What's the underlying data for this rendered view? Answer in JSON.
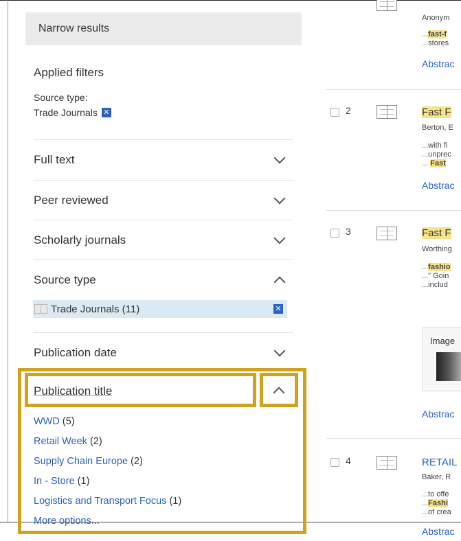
{
  "sidebar": {
    "header": "Narrow results",
    "applied_filters": {
      "title": "Applied filters",
      "source_type_label": "Source type:",
      "source_type_value": "Trade Journals",
      "remove_glyph": "✕"
    },
    "facets": [
      "Full text",
      "Peer reviewed",
      "Scholarly journals",
      "Source type",
      "Publication date"
    ],
    "source_type_selected": "Trade Journals (11)",
    "publication_title": {
      "label": "Publication title",
      "options": [
        {
          "name": "WWD",
          "count": "(5)"
        },
        {
          "name": "Retail Week",
          "count": "(2)"
        },
        {
          "name": "Supply Chain Europe",
          "count": "(2)"
        },
        {
          "name": "In - Store",
          "count": "(1)"
        },
        {
          "name": "Logistics and Transport Focus",
          "count": "(1)"
        }
      ],
      "more_options": "More options..."
    }
  },
  "results": {
    "r1": {
      "author": "Anonym",
      "snip1_pre": "...",
      "snip1_mark": "fast-f",
      "snip2": "...stores",
      "abstract": "Abstrac"
    },
    "r2": {
      "num": "2",
      "title_mark": "Fast F",
      "author": "Berton, E",
      "snip1": "...with fi",
      "snip2": "...unprec",
      "snip3_pre": "...  ",
      "snip3_mark": "Fast",
      "abstract": "Abstrac"
    },
    "r3": {
      "num": "3",
      "title_mark": "Fast F",
      "author": "Worthing",
      "snip1_pre": "...",
      "snip1_mark": "fashio",
      "snip2": "...\" Goin",
      "snip3": "...includ",
      "image_label": "Image",
      "abstract": "Abstrac"
    },
    "r4": {
      "num": "4",
      "title": "RETAIL",
      "author": "Baker, R",
      "snip1": "...to offe",
      "snip2_pre": "...",
      "snip2_mark": "Fashi",
      "snip3": "...of crea",
      "abstract": "Abstrac"
    }
  },
  "colors": {
    "accent_link": "#2a62c4",
    "highlight_border": "#d1a21d",
    "keyword_highlight": "#f6e38a",
    "selected_row": "#dbe9f5"
  }
}
